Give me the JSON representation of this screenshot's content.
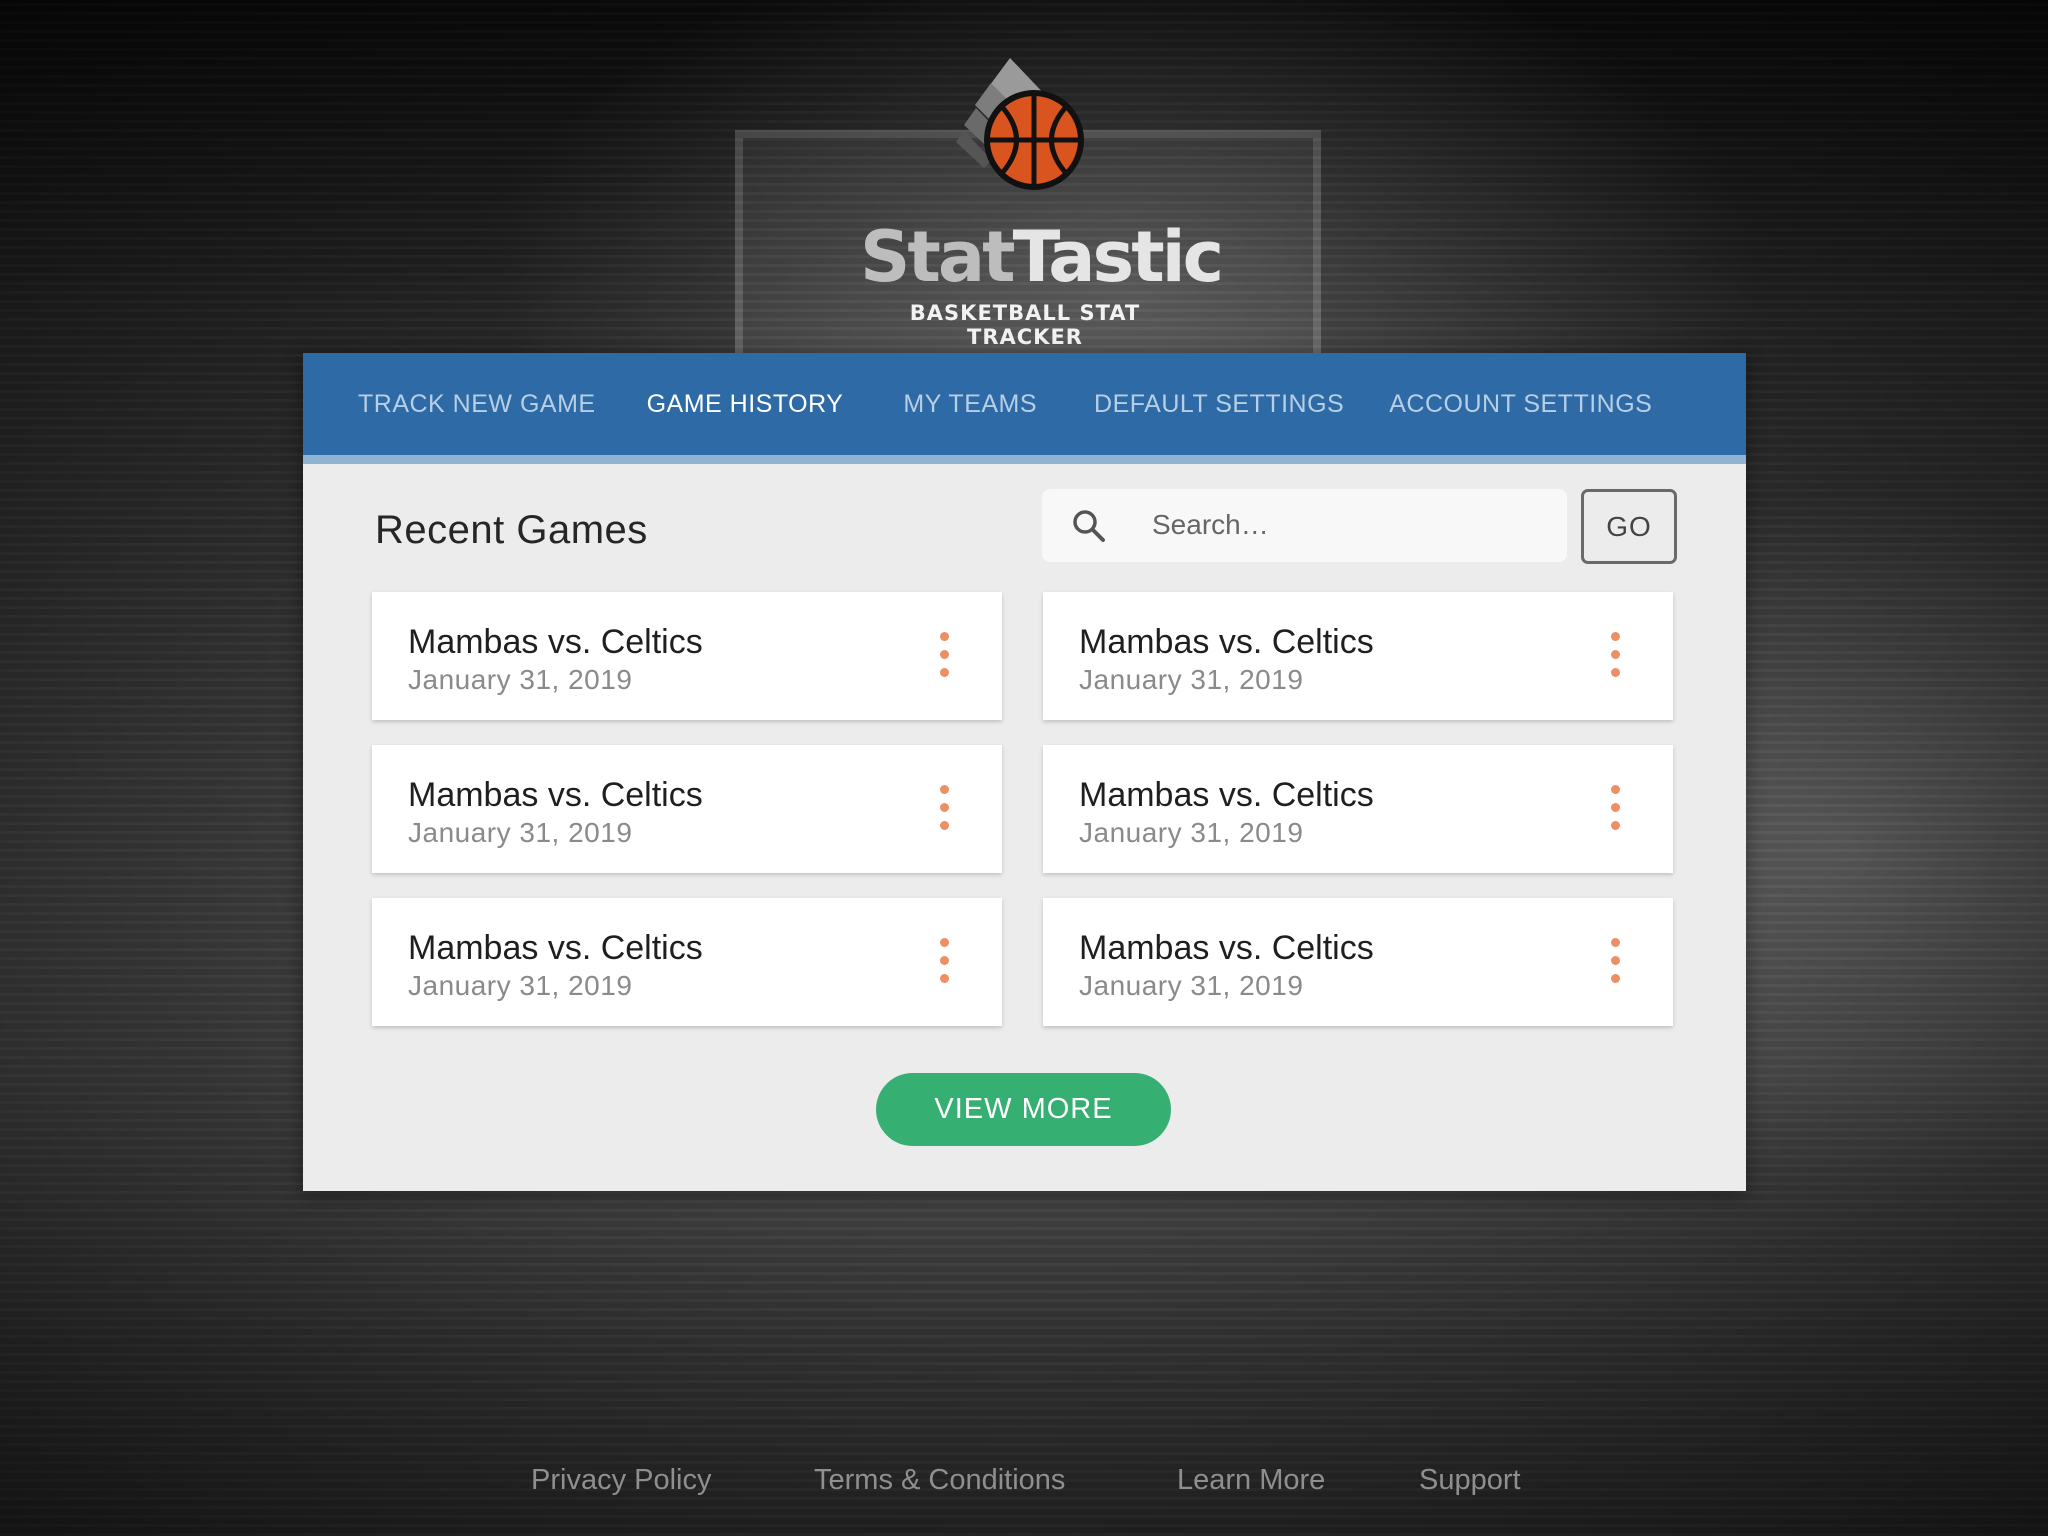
{
  "brand": {
    "title_part1": "Stat",
    "title_part2": "Tastic",
    "subtitle": "BASKETBALL STAT TRACKER",
    "ball_color": "#d9541f",
    "logo_icon": "basketball-icon"
  },
  "nav": {
    "items": [
      {
        "label": "TRACK NEW GAME",
        "active": false
      },
      {
        "label": "GAME HISTORY",
        "active": true
      },
      {
        "label": "MY TEAMS",
        "active": false
      },
      {
        "label": "DEFAULT SETTINGS",
        "active": false
      },
      {
        "label": "ACCOUNT SETTINGS",
        "active": false
      }
    ],
    "bg_color": "#2d6aa6"
  },
  "main": {
    "heading": "Recent Games",
    "search": {
      "placeholder": "Search…",
      "value": "",
      "icon": "search-icon",
      "go_label": "GO"
    },
    "games": [
      {
        "title": "Mambas vs. Celtics",
        "date": "January 31, 2019"
      },
      {
        "title": "Mambas vs. Celtics",
        "date": "January 31, 2019"
      },
      {
        "title": "Mambas vs. Celtics",
        "date": "January 31, 2019"
      },
      {
        "title": "Mambas vs. Celtics",
        "date": "January 31, 2019"
      },
      {
        "title": "Mambas vs. Celtics",
        "date": "January 31, 2019"
      },
      {
        "title": "Mambas vs. Celtics",
        "date": "January 31, 2019"
      }
    ],
    "view_more_label": "VIEW MORE",
    "accent_color": "#36b072",
    "menu_dot_color": "#ec8f64"
  },
  "footer": {
    "links": [
      "Privacy Policy",
      "Terms & Conditions",
      "Learn More",
      "Support"
    ]
  }
}
